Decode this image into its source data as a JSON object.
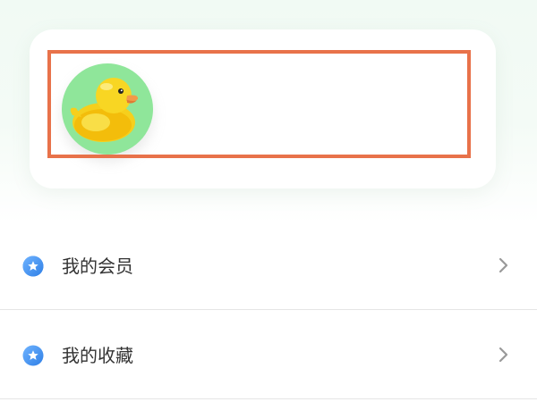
{
  "profile": {
    "avatar_icon": "duck-avatar-icon",
    "avatar_bg_color": "#8fe69a",
    "highlight_color": "#e8724a"
  },
  "menu": {
    "items": [
      {
        "label": "我的会员",
        "icon": "star-badge-icon",
        "chevron": "chevron-right-icon"
      },
      {
        "label": "我的收藏",
        "icon": "star-badge-icon",
        "chevron": "chevron-right-icon"
      }
    ],
    "icon_color": "#3d8ff0"
  }
}
